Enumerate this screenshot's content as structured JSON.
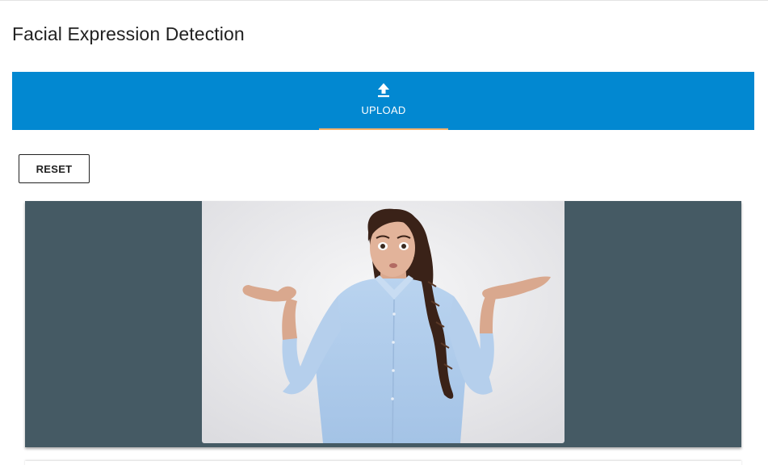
{
  "header": {
    "title": "Facial Expression Detection"
  },
  "tabs": [
    {
      "label": "UPLOAD",
      "icon": "upload-icon",
      "selected": true
    }
  ],
  "actions": {
    "reset_label": "RESET"
  },
  "image_viewer": {
    "content": "photo"
  },
  "colors": {
    "tabbar": "#0288d1",
    "tab_indicator": "#f4b26a",
    "viewer_background": "#455a64"
  }
}
